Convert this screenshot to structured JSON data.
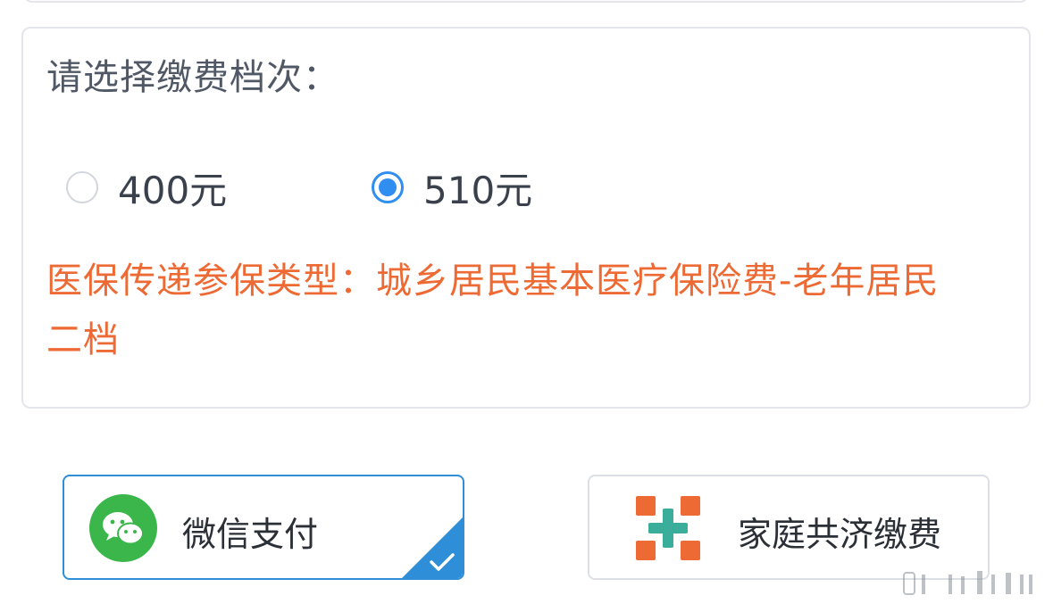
{
  "tier_section": {
    "label": "请选择缴费档次：",
    "options": [
      {
        "label": "400元",
        "selected": false
      },
      {
        "label": "510元",
        "selected": true
      }
    ],
    "insurance_type_note": "医保传递参保类型：城乡居民基本医疗保险费-老年居民二档"
  },
  "payment_methods": {
    "wechat": {
      "label": "微信支付",
      "icon": "wechat-icon",
      "selected": true
    },
    "family": {
      "label": "家庭共济缴费",
      "icon": "family-mutual-aid-icon",
      "selected": false
    }
  },
  "colors": {
    "accent_blue": "#2f8ef0",
    "note_orange": "#ee6a34",
    "wechat_green": "#3bb64a",
    "family_orange": "#ee6a34",
    "family_teal": "#3aae9a"
  }
}
